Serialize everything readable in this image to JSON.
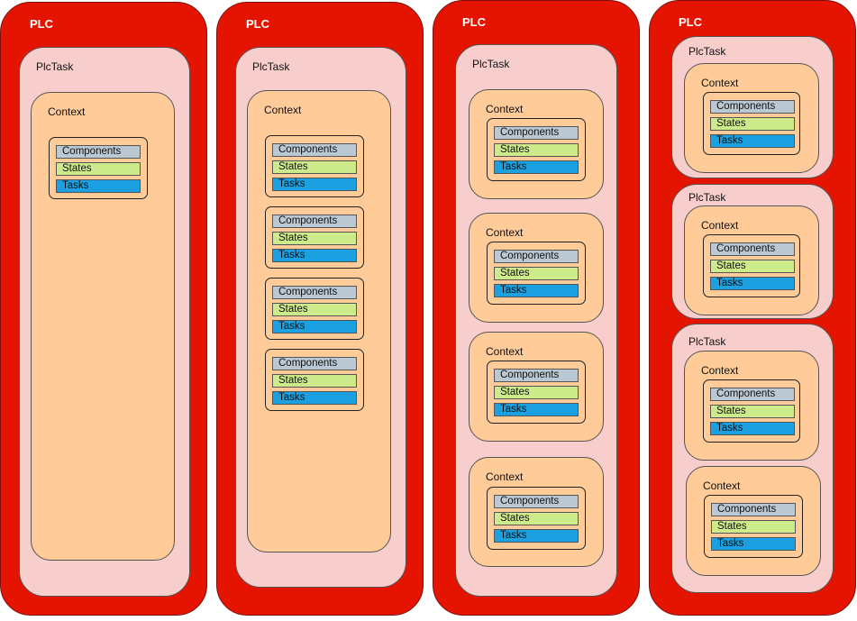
{
  "colors": {
    "plc": "#e51400",
    "plctask": "#f8cecc",
    "context": "#ffcc99",
    "components": "#bac8d3",
    "states": "#cdeb8b",
    "tasks": "#1ba1e2"
  },
  "labels": {
    "plc": "PLC",
    "plctask": "PlcTask",
    "context": "Context",
    "components": "Components",
    "states": "States",
    "tasks": "Tasks"
  }
}
